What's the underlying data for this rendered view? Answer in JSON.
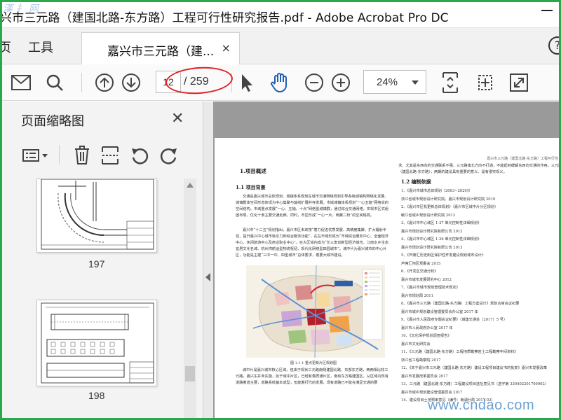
{
  "window": {
    "title": "兴市三元路（建国北路-东方路）工程可行性研究报告.pdf - Adobe Acrobat Pro DC",
    "watermark_top": "漢 扌 网"
  },
  "menubar": {
    "menu_items": [
      "页",
      "工具"
    ],
    "tab_label": "嘉兴市三元路（建...",
    "tab_close": "×",
    "help": "?"
  },
  "toolbar": {
    "current_page": "12",
    "total_pages": "/ 259",
    "zoom": "24%"
  },
  "panel": {
    "title": "页面缩略图",
    "close": "✕",
    "thumbnails": [
      {
        "label": "197"
      },
      {
        "label": "198"
      }
    ]
  },
  "document": {
    "running_head": "嘉兴市三元路（建国北路-东方路）工程可行性",
    "left_column": {
      "section_title": "1.项目概述",
      "subsection_title": "1.1 项目背景",
      "para1": "交通是嘉兴城市总体规划、城镇体系规划在城市交通网络规划引导各级城镇构网络化发展、城镇群体空间形态体现为中心集聚与轴线扩展并存发展。市域城镇体系规划“一心五轴”网络状的空间结构。市域重点发展“一心、五轴、十点”网络型城镇群，通过综合交通网络，实现市区式组团布局，优化十条主要交通走廊。同时，市区形成“一心一片，两翼二桥”的空间格局。",
      "para2": "嘉兴市“十二五”规划指出，嘉兴市区未来按“着力促进优质发展、高精度集聚、扩大辐射半径、提升嘉兴中心城市吸引力和综合服务功能”，在在市域形成为“市域综合服务中心、全面经济中心、休闲旅游中心及商业职业中心”，在大区域内成为“长三角创新型经济城市、江南水乡生态宜居文化名城、杭州湾航运型物流枢纽、现代化网络型田园城市”。城中片为嘉兴城市的中心片区，功能是主建“三中一中、四型城市”总体要求，着要大城市建设。",
      "caption": "图 1.1-1  重点更新片区规划图",
      "para3": "城中片是嘉兴城市核心区域，但由于现状三元路南侧建国北路、东部东方路，两两相比较三元路，嘉兴东并未实施，处于城中片区，已经有着质通片区，南有东方路建国区，从区域内现有道路着道主要，道路系统基本成型，但能着打代的发展，现有道路已不能在满足交通的要"
    },
    "right_column": {
      "top_text": "求。尤其是东西向的交通联系不强，三元路南北方向不打通，不能起到缓解东西向交通的作用。三元路（建国北路-东方路），两期的建设具有重要的意义、是有很实现义。",
      "subsection_title": "1.2 编制依据",
      "refs": [
        "1、《嘉兴市城市总体规划（2003~2020)》",
        "    浙江省城市规划设计研究院、嘉兴市规划设计研究院 2010",
        "2、《嘉兴市区机更新总体规划》（嘉兴市区域中片分区规划）",
        "    敏江省城乡规划设计研究院 2013",
        "3、《嘉兴市中心城区 1-37 单元控制性详细规划》",
        "    嘉兴市规划设计研究院有限公司 2012",
        "4、《嘉兴市中心城区 1-26 单元控制性详细规划》",
        "    嘉兴市规划设计研究院有限公司 2013",
        "5、《芦席汇历史街区保护性开发建设规划城市设计》",
        "    芦席汇地区规委会 2015",
        "6、《开发区交通分析》",
        "    嘉兴市城市发展研究中心 2012",
        "7、《嘉兴市城市规划管理技术规定》",
        "    嘉兴市规划局 2011",
        "8、《嘉兴市三元路（建国北路-东方路）工程方案设计》规划合审会议纪要",
        "    嘉兴市城乡规划建设管理委员会办公室 2017 年",
        "9、《嘉兴市人民政府专题会议纪要》（城建交通处（2017）5 号）",
        "    嘉兴市人民政府办公室 2017 年",
        "10、《文化保护规划调查报告》",
        "    嘉兴市文化研究会",
        "11、《三元路（建国北路-东方路）工程地质勘察岩土工程勘察中间资料》",
        "    浙江省工程勘察院 2017",
        "12、《关于嘉兴市三元路（建国北路-东方路）建设工程项目建议书的批复》嘉兴市发展改革",
        "    嘉兴市发展改革委员会 2017",
        "13、三元路（建国北路-东方路）工程建设项目选址意见书（选字第 330402201700002）",
        "    嘉兴市城乡规划建设管理委员会 2017",
        "14、建设项目土地预审意见（编号：南湖分局 2017-02）"
      ]
    }
  },
  "watermark_bottom": "www.cndao.com"
}
